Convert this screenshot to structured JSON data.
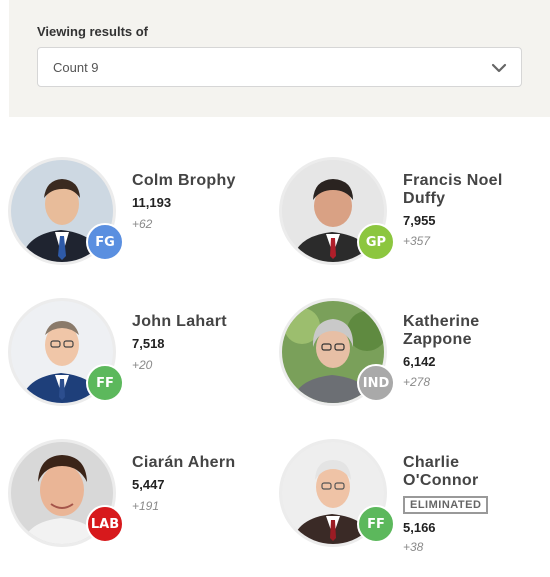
{
  "filter": {
    "label": "Viewing results of",
    "selected": "Count 9"
  },
  "colors": {
    "FG": "#5a8fe0",
    "GP": "#8cc63f",
    "FF": "#5cb85c",
    "IND": "#a9a9a9",
    "LAB": "#d7191c"
  },
  "candidates": [
    {
      "name": "Colm Brophy",
      "votes": "11,193",
      "change": "+62",
      "party": "FG",
      "eliminated": false
    },
    {
      "name": "Francis Noel Duffy",
      "votes": "7,955",
      "change": "+357",
      "party": "GP",
      "eliminated": false
    },
    {
      "name": "John Lahart",
      "votes": "7,518",
      "change": "+20",
      "party": "FF",
      "eliminated": false
    },
    {
      "name": "Katherine Zappone",
      "votes": "6,142",
      "change": "+278",
      "party": "IND",
      "eliminated": false
    },
    {
      "name": "Ciarán Ahern",
      "votes": "5,447",
      "change": "+191",
      "party": "LAB",
      "eliminated": false
    },
    {
      "name": "Charlie O'Connor",
      "votes": "5,166",
      "change": "+38",
      "party": "FF",
      "eliminated": true,
      "status_label": "ELIMINATED"
    }
  ]
}
